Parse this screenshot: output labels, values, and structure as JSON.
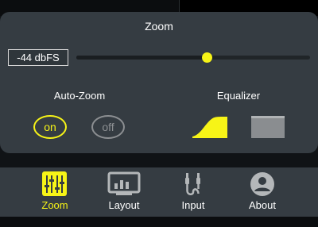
{
  "zoom_section": {
    "title": "Zoom",
    "level_readout": "-44 dbFS",
    "slider_level_fraction": 0.56
  },
  "auto_zoom": {
    "label": "Auto-Zoom",
    "on_label": "on",
    "off_label": "off",
    "selected": "on"
  },
  "equalizer": {
    "label": "Equalizer",
    "options": [
      "high-shelf-curve",
      "flat"
    ],
    "selected": "high-shelf-curve"
  },
  "tabs": [
    {
      "label": "Zoom",
      "icon": "sliders-icon",
      "active": true
    },
    {
      "label": "Layout",
      "icon": "layout-chart-icon",
      "active": false
    },
    {
      "label": "Input",
      "icon": "audio-jack-icon",
      "active": false
    },
    {
      "label": "About",
      "icon": "user-icon",
      "active": false
    }
  ],
  "colors": {
    "accent": "#f7f417",
    "panel": "#353c42",
    "inactive": "#8c8f92",
    "background": "#101316"
  }
}
